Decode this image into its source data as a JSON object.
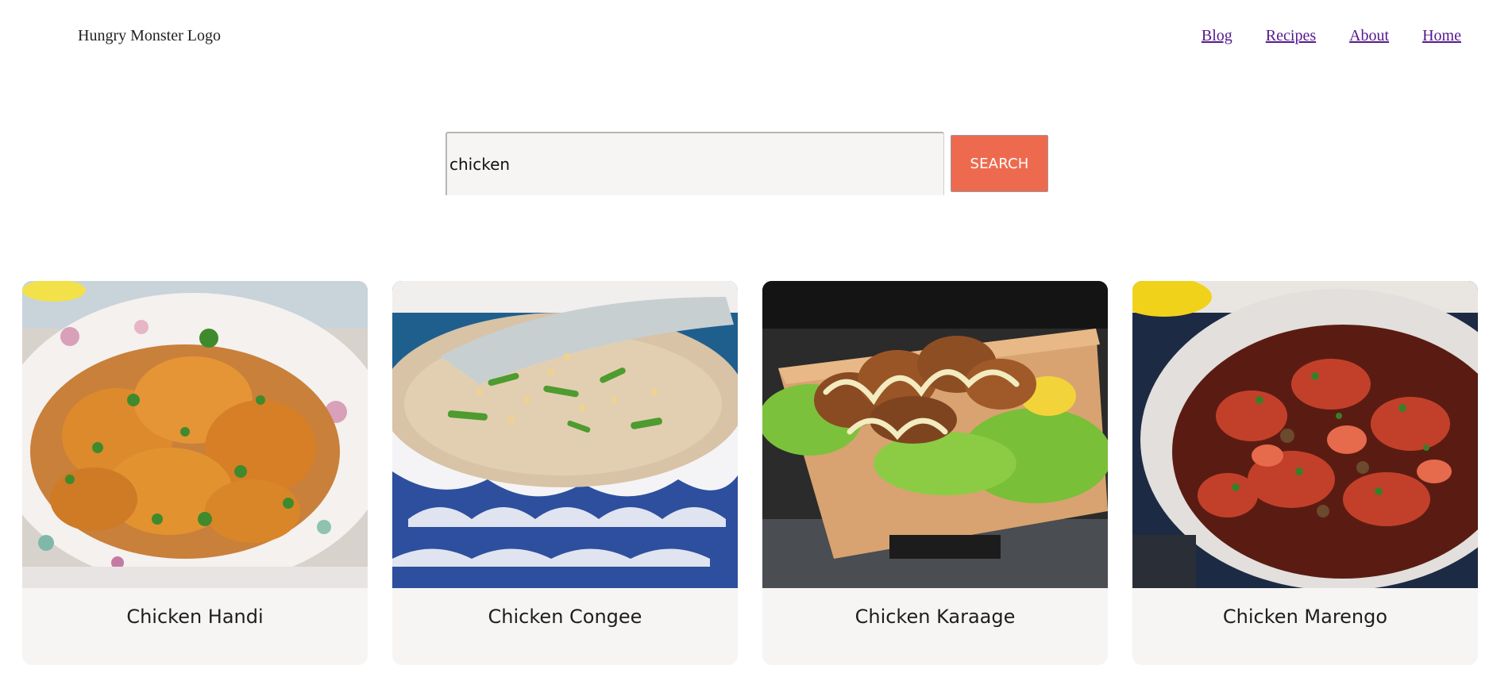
{
  "header": {
    "logo_text": "Hungry Monster Logo",
    "nav": [
      {
        "label": "Blog"
      },
      {
        "label": "Recipes"
      },
      {
        "label": "About"
      },
      {
        "label": "Home"
      }
    ]
  },
  "search": {
    "value": "chicken",
    "button_label": "SEARCH"
  },
  "results": [
    {
      "title": "Chicken Handi",
      "image": "chicken-handi-photo"
    },
    {
      "title": "Chicken Congee",
      "image": "chicken-congee-photo"
    },
    {
      "title": "Chicken Karaage",
      "image": "chicken-karaage-photo"
    },
    {
      "title": "Chicken Marengo",
      "image": "chicken-marengo-photo"
    }
  ],
  "colors": {
    "search_button": "#ee6a4e",
    "input_bg": "#f7f5f3",
    "card_bg": "#f7f5f3",
    "nav_link": "#551a8b"
  }
}
